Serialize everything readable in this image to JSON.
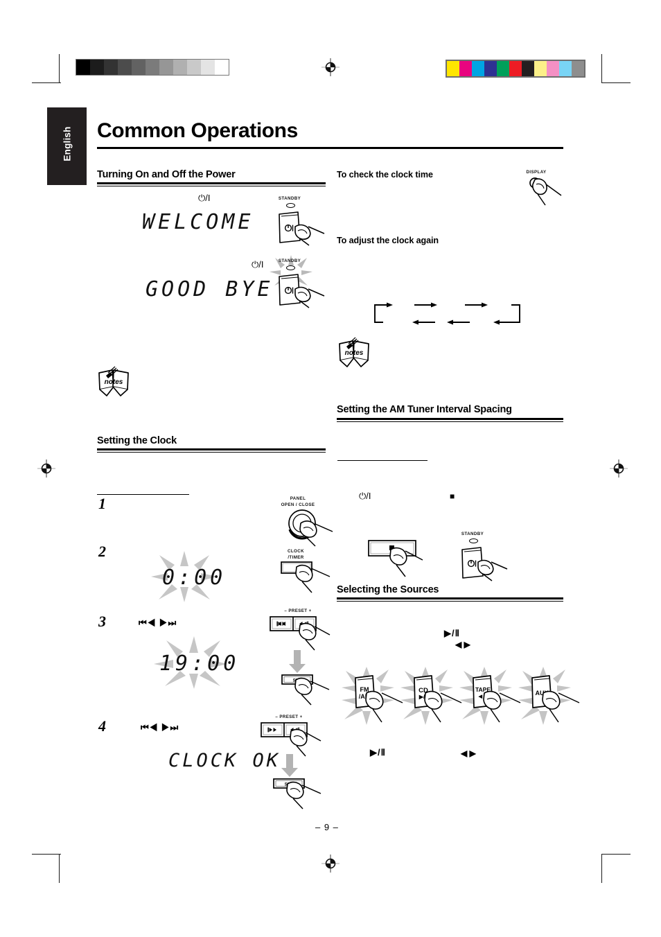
{
  "page": {
    "number": "– 9 –",
    "language_tab": "English",
    "title": "Common Operations"
  },
  "print_marks": {
    "grayscale_steps": [
      "#000000",
      "#1c1c1c",
      "#333333",
      "#4c4c4c",
      "#626262",
      "#7b7b7b",
      "#969696",
      "#b0b0b0",
      "#c9c9c9",
      "#e4e4e4",
      "#ffffff"
    ],
    "color_patches": [
      "#ffe600",
      "#e8047f",
      "#00a5e3",
      "#2e3192",
      "#00a05a",
      "#ed1c24",
      "#231f20",
      "#fcf089",
      "#f490c4",
      "#79d4f5",
      "#8e8e8e"
    ],
    "registration_icon": "registration-target-icon"
  },
  "left_column": {
    "section1": {
      "heading": "Turning On and Off the Power",
      "power_symbol": "⏻/I",
      "display_on": "WELCOME",
      "display_off": "GOOD BYE",
      "standby_label": "STANDBY",
      "button_face": "⏻/I",
      "notes_icon_label": "notes"
    },
    "section2": {
      "heading": "Setting the Clock",
      "steps": [
        {
          "num": "1",
          "device_label_line1": "PANEL",
          "device_label_line2": "OPEN / CLOSE",
          "device_type": "knob"
        },
        {
          "num": "2",
          "display": "0:00",
          "device_label_line1": "CLOCK",
          "device_label_line2": "/TIMER",
          "device_type": "button"
        },
        {
          "num": "3",
          "symbols": "⏮◀  ▶⏭",
          "display": "19:00",
          "device_label_top": "– PRESET +",
          "device_left": "⏮◀",
          "device_right": "▶⏭",
          "device_set": "SET",
          "device_type": "preset-pair"
        },
        {
          "num": "4",
          "symbols": "⏮◀  ▶⏭",
          "display": "CLOCK OK",
          "device_label_top": "– PRESET +",
          "device_left": "⏮◀",
          "device_right": "▶⏭",
          "device_set": "SET",
          "device_type": "preset-pair"
        }
      ]
    }
  },
  "right_column": {
    "sub1": {
      "heading": "To check the clock time",
      "device_label": "DISPLAY"
    },
    "sub2": {
      "heading": "To adjust the clock again",
      "flow_icon": "cyclic-flow-arrows",
      "notes_icon_label": "notes"
    },
    "section3": {
      "heading": "Setting the AM Tuner Interval Spacing",
      "power_symbol": "⏻/I",
      "stop_symbol": "■",
      "stop_button_face": "■",
      "standby_label": "STANDBY",
      "standby_button_face": "⏻/I"
    },
    "section4": {
      "heading": "Selecting the Sources",
      "play_pause_symbol": "▶/Ⅱ",
      "tape_symbol": "◀ ▶",
      "sources": [
        {
          "name": "FM /AM",
          "line1": "FM",
          "line2": "/AM"
        },
        {
          "name": "CD",
          "line1": "CD",
          "line2": "▶/Ⅱ"
        },
        {
          "name": "TAPE",
          "line1": "TAPE",
          "line2": "◀ ▶"
        },
        {
          "name": "AUX",
          "line1": "AUX",
          "line2": ""
        }
      ],
      "footer_play_pause": "▶/Ⅱ",
      "footer_tape": "◀ ▶"
    }
  }
}
